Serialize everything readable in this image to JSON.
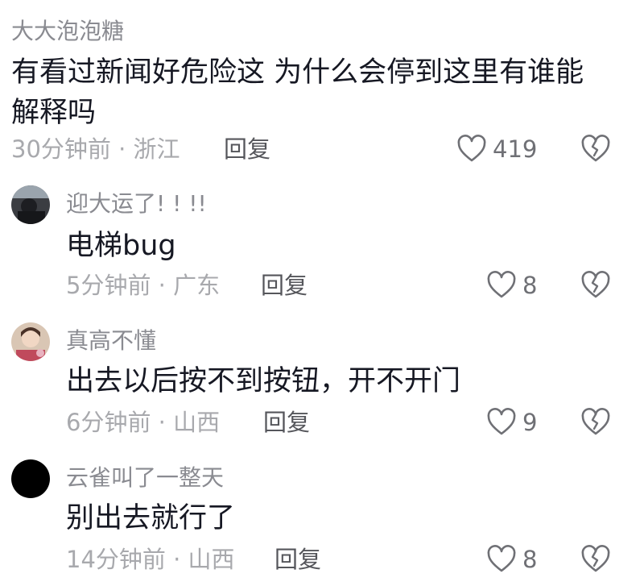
{
  "comments": [
    {
      "username": "大大泡泡糖",
      "text": "有看过新闻好危险这 为什么会停到这里有谁能解释吗",
      "time_location": "30分钟前 · 浙江",
      "reply_label": "回复",
      "likes": "419"
    }
  ],
  "replies": [
    {
      "username": "迎大运了! ! !!",
      "text": "电梯bug",
      "time_location": "5分钟前 · 广东",
      "reply_label": "回复",
      "likes": "8"
    },
    {
      "username": "真高不懂",
      "text": "出去以后按不到按钮，开不开门",
      "time_location": "6分钟前 · 山西",
      "reply_label": "回复",
      "likes": "9"
    },
    {
      "username": "云雀叫了一整天",
      "text": "别出去就行了",
      "time_location": "14分钟前 · 山西",
      "reply_label": "回复",
      "likes": "8"
    }
  ],
  "icons": {
    "like": "heart-outline-icon",
    "dislike": "broken-heart-icon"
  },
  "colors": {
    "text": "#161823",
    "username": "#8a8b91",
    "meta": "#a8a9ad",
    "reply": "#55565b",
    "icon": "#6f7075"
  }
}
